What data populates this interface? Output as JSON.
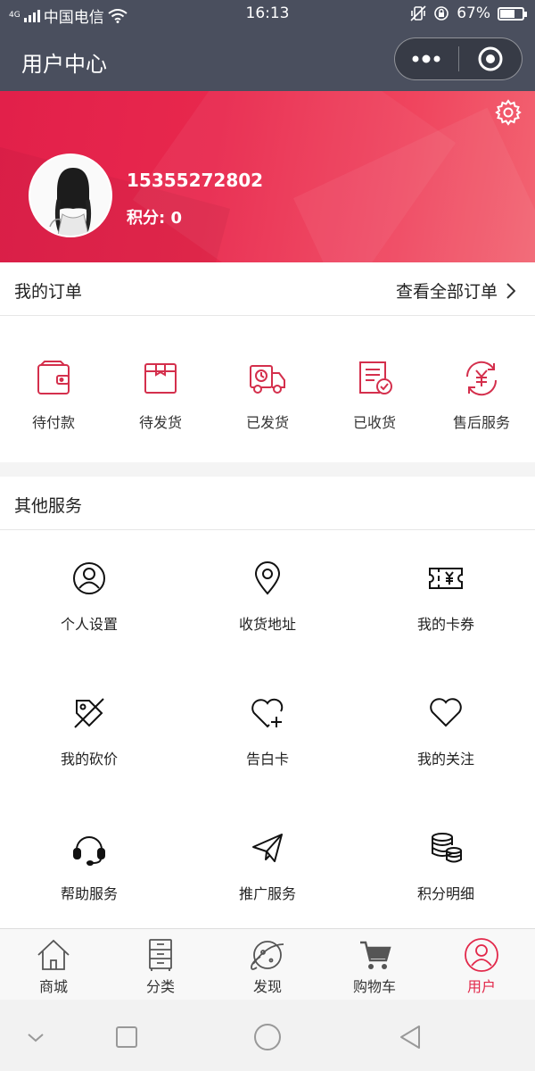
{
  "status_bar": {
    "carrier": "中国电信",
    "network": "4G",
    "time": "16:13",
    "battery": "67%",
    "battery_level": 0.67
  },
  "title_bar": {
    "title": "用户中心"
  },
  "profile": {
    "phone": "15355272802",
    "points_label": "积分:",
    "points_value": "0"
  },
  "orders": {
    "heading": "我的订单",
    "view_all": "查看全部订单",
    "items": [
      {
        "label": "待付款",
        "icon": "wallet-icon"
      },
      {
        "label": "待发货",
        "icon": "package-icon"
      },
      {
        "label": "已发货",
        "icon": "truck-icon"
      },
      {
        "label": "已收货",
        "icon": "received-icon"
      },
      {
        "label": "售后服务",
        "icon": "refund-icon"
      }
    ]
  },
  "services": {
    "heading": "其他服务",
    "items": [
      {
        "label": "个人设置",
        "icon": "user-icon"
      },
      {
        "label": "收货地址",
        "icon": "location-icon"
      },
      {
        "label": "我的卡券",
        "icon": "coupon-icon"
      },
      {
        "label": "我的砍价",
        "icon": "tag-icon"
      },
      {
        "label": "告白卡",
        "icon": "heart-plus-icon"
      },
      {
        "label": "我的关注",
        "icon": "heart-icon"
      },
      {
        "label": "帮助服务",
        "icon": "headset-icon"
      },
      {
        "label": "推广服务",
        "icon": "paper-plane-icon"
      },
      {
        "label": "积分明细",
        "icon": "coins-icon"
      }
    ]
  },
  "tabs": [
    {
      "label": "商城",
      "icon": "home-icon"
    },
    {
      "label": "分类",
      "icon": "cabinet-icon"
    },
    {
      "label": "发现",
      "icon": "planet-icon"
    },
    {
      "label": "购物车",
      "icon": "cart-icon"
    },
    {
      "label": "用户",
      "icon": "user-circle-icon",
      "active": true
    }
  ],
  "colors": {
    "brand": "#e2284a",
    "title_bar": "#4a4f5e",
    "icon_accent": "#d42f4c"
  }
}
